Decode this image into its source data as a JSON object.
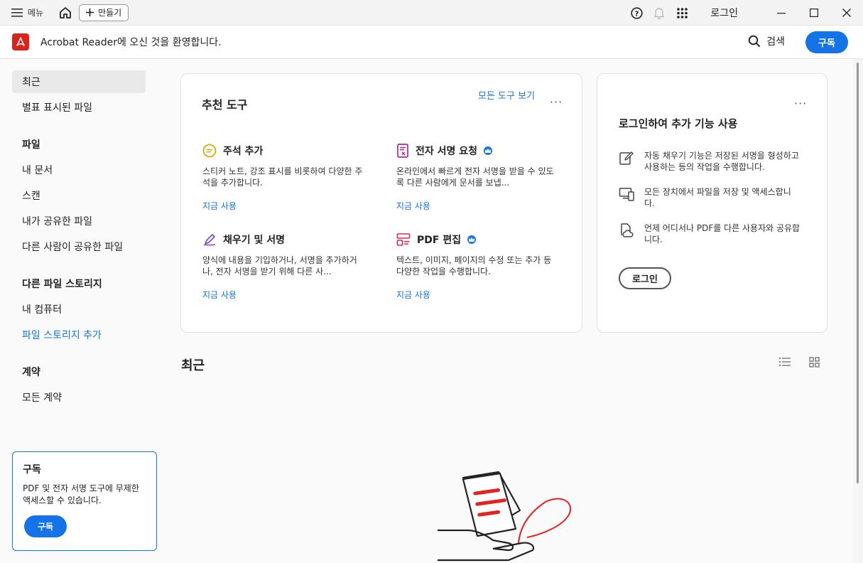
{
  "titlebar": {
    "menu_label": "메뉴",
    "create_label": "만들기",
    "login_label": "로그인"
  },
  "header": {
    "welcome_text": "Acrobat Reader에 오신 것을 환영합니다.",
    "search_label": "검색",
    "subscribe_label": "구독"
  },
  "sidebar": {
    "recent": "최근",
    "starred": "별표 표시된 파일",
    "files_heading": "파일",
    "my_documents": "내 문서",
    "scan": "스캔",
    "shared_by_me": "내가 공유한 파일",
    "shared_by_others": "다른 사람이 공유한 파일",
    "storage_heading": "다른 파일 스토리지",
    "my_computer": "내 컴퓨터",
    "add_storage": "파일 스토리지 추가",
    "agreements_heading": "계약",
    "all_agreements": "모든 계약",
    "subscribe_card": {
      "title": "구독",
      "description": "PDF 및 전자 서명 도구에 무제한 액세스할 수 있습니다.",
      "button": "구독"
    }
  },
  "tools_card": {
    "title": "추천 도구",
    "view_all": "모든 도구 보기",
    "more": "···",
    "tools": [
      {
        "name": "주석 추가",
        "description": "스티커 노트, 강조 표시를 비롯하여 다양한 주석을 추가합니다.",
        "link": "지금 사용"
      },
      {
        "name": "전자 서명 요청",
        "description": "온라인에서 빠르게 전자 서명을 받을 수 있도록 다른 사람에게 문서를 보냅...",
        "link": "지금 사용"
      },
      {
        "name": "채우기 및 서명",
        "description": "양식에 내용을 기입하거나, 서명을 추가하거나, 전자 서명을 받기 위해 다른 사...",
        "link": "지금 사용"
      },
      {
        "name": "PDF 편집",
        "description": "텍스트, 이미지, 페이지의 수정 또는 추가 등 다양한 작업을 수행합니다.",
        "link": "지금 사용"
      }
    ]
  },
  "login_card": {
    "title": "로그인하여 추가 기능 사용",
    "more": "···",
    "features": [
      "자동 채우기 기능은 저장된 서명을 형성하고 사용하는 등의 작업을 수행합니다.",
      "모든 장치에서 파일을 저장 및 액세스합니다.",
      "언제 어디서나 PDF를 다른 사용자와 공유합니다."
    ],
    "button": "로그인"
  },
  "recent_section": {
    "title": "최근"
  },
  "colors": {
    "accent": "#1473e6",
    "brand_red": "#d9241b"
  }
}
